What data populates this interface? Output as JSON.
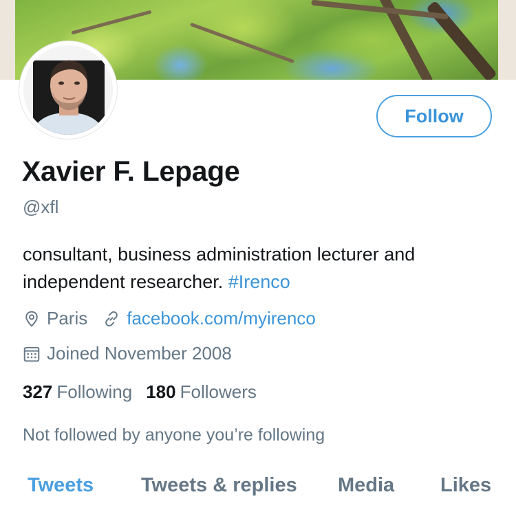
{
  "profile": {
    "name": "Xavier F. Lepage",
    "handle": "@xfl",
    "bio_text": "consultant, business administration lecturer and independent researcher. ",
    "bio_hashtag": "#Irenco",
    "location": "Paris",
    "website": "facebook.com/myirenco",
    "joined": "Joined November 2008",
    "not_followed_text": "Not followed by anyone you’re following"
  },
  "follow_button": {
    "label": "Follow"
  },
  "stats": {
    "following_count": "327",
    "following_label": "Following",
    "followers_count": "180",
    "followers_label": "Followers"
  },
  "tabs": [
    {
      "label": "Tweets",
      "active": true
    },
    {
      "label": "Tweets & replies",
      "active": false
    },
    {
      "label": "Media",
      "active": false
    },
    {
      "label": "Likes",
      "active": false
    }
  ],
  "icons": {
    "location": "location-pin-icon",
    "website": "link-icon",
    "joined": "calendar-icon"
  },
  "colors": {
    "accent": "#4a9fe0",
    "text_primary": "#14171a",
    "text_secondary": "#657786"
  }
}
